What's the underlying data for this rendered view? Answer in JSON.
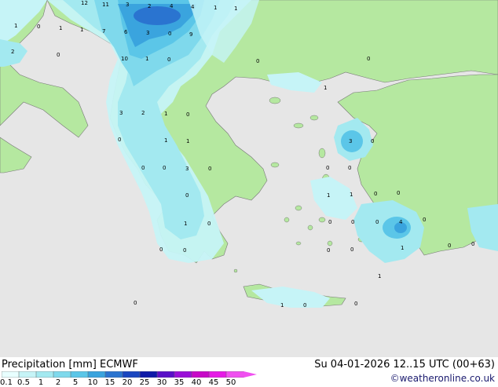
{
  "title": "Precipitation [mm]  ECMWF",
  "datetime": "Su 04-01-2026 12..15 UTC (00+63)",
  "credit": "©weatheronline.co.uk",
  "legend": {
    "labels": [
      "0.1",
      "0.5",
      "1",
      "2",
      "5",
      "10",
      "15",
      "20",
      "25",
      "30",
      "35",
      "40",
      "45",
      "50"
    ],
    "colors": [
      "#e8ffff",
      "#c6f4f7",
      "#a3e9f0",
      "#7fd9ec",
      "#5bc6e8",
      "#3aa4de",
      "#2a74d0",
      "#1a46c0",
      "#0e1aa8",
      "#5a10c8",
      "#9a10d8",
      "#c80ac8",
      "#e61ae6",
      "#f050f0"
    ]
  },
  "map_labels": [
    {
      "text": "12"
    },
    {
      "text": "11"
    },
    {
      "text": "3"
    },
    {
      "text": "2"
    },
    {
      "text": "4"
    },
    {
      "text": "4"
    },
    {
      "text": "1"
    },
    {
      "text": "1"
    },
    {
      "text": "1"
    },
    {
      "text": "0"
    },
    {
      "text": "1"
    },
    {
      "text": "1"
    },
    {
      "text": "7"
    },
    {
      "text": "6"
    },
    {
      "text": "3"
    },
    {
      "text": "0"
    },
    {
      "text": "9"
    },
    {
      "text": "2"
    },
    {
      "text": "0"
    },
    {
      "text": "10"
    },
    {
      "text": "1"
    },
    {
      "text": "0"
    },
    {
      "text": "0"
    },
    {
      "text": "0"
    },
    {
      "text": "1"
    },
    {
      "text": "3"
    },
    {
      "text": "2"
    },
    {
      "text": "1"
    },
    {
      "text": "0"
    },
    {
      "text": "0"
    },
    {
      "text": "1"
    },
    {
      "text": "1"
    },
    {
      "text": "3"
    },
    {
      "text": "0"
    },
    {
      "text": "0"
    },
    {
      "text": "0"
    },
    {
      "text": "3"
    },
    {
      "text": "0"
    },
    {
      "text": "0"
    },
    {
      "text": "0"
    },
    {
      "text": "0"
    },
    {
      "text": "1"
    },
    {
      "text": "1"
    },
    {
      "text": "0"
    },
    {
      "text": "0"
    },
    {
      "text": "0"
    },
    {
      "text": "0"
    },
    {
      "text": "0"
    },
    {
      "text": "1"
    },
    {
      "text": "0"
    },
    {
      "text": "0"
    },
    {
      "text": "0"
    },
    {
      "text": "0"
    },
    {
      "text": "0"
    },
    {
      "text": "4"
    },
    {
      "text": "0"
    },
    {
      "text": "1"
    },
    {
      "text": "0"
    },
    {
      "text": "0"
    },
    {
      "text": "1"
    },
    {
      "text": "0"
    },
    {
      "text": "1"
    },
    {
      "text": "0"
    },
    {
      "text": "0"
    }
  ]
}
